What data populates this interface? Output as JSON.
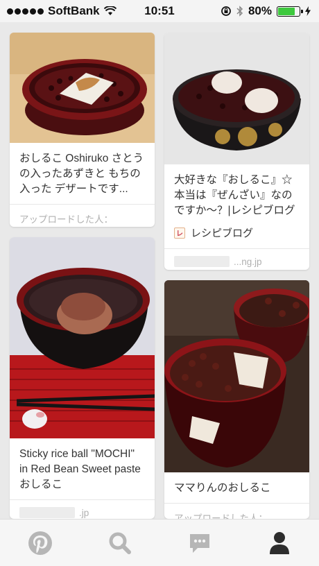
{
  "status_bar": {
    "carrier": "SoftBank",
    "time": "10:51",
    "battery": "80%",
    "battery_level": 0.8
  },
  "pins": [
    {
      "title": "おしるこ Oshiruko さとうの入ったあずきと もちの入った デザートです...",
      "meta_label": "アップロードした人："
    },
    {
      "title": "大好きな『おしるこ』☆本当は『ぜんざい』なのですか〜？|レシピブログ",
      "source_name": "レシピブログ",
      "source_icon": "recipe-blog-favicon",
      "domain": "...ng.jp"
    },
    {
      "title": "Sticky rice ball \"MOCHI\" in Red Bean Sweet paste おしるこ",
      "domain": ".jp"
    },
    {
      "title": "ママりんのおしるこ",
      "meta_label": "アップロードした人："
    }
  ],
  "tab_bar": {
    "items": [
      "pinterest-home-icon",
      "search-icon",
      "messages-icon",
      "profile-icon"
    ],
    "active": "profile-icon"
  }
}
